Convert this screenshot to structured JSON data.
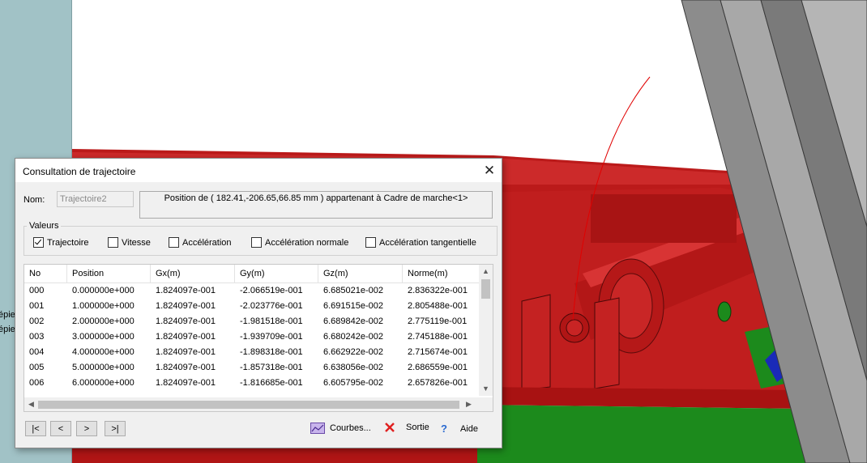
{
  "background": {
    "left_snippets": [
      "épie",
      "épie"
    ]
  },
  "dialog": {
    "title": "Consultation de trajectoire",
    "close_glyph": "✕",
    "nom_label": "Nom:",
    "nom_value": "Trajectoire2",
    "position_text": "Position de ( 182.41,-206.65,66.85  mm ) appartenant à Cadre de marche<1>",
    "group_label": "Valeurs",
    "checkboxes": [
      {
        "label": "Trajectoire",
        "checked": true
      },
      {
        "label": "Vitesse",
        "checked": false
      },
      {
        "label": "Accélération",
        "checked": false
      },
      {
        "label": "Accélération normale",
        "checked": false
      },
      {
        "label": "Accélération tangentielle",
        "checked": false
      }
    ],
    "table": {
      "headers": [
        "No",
        "Position",
        "Gx(m)",
        "Gy(m)",
        "Gz(m)",
        "Norme(m)"
      ],
      "rows": [
        [
          "000",
          "0.000000e+000",
          "1.824097e-001",
          "-2.066519e-001",
          "6.685021e-002",
          "2.836322e-001"
        ],
        [
          "001",
          "1.000000e+000",
          "1.824097e-001",
          "-2.023776e-001",
          "6.691515e-002",
          "2.805488e-001"
        ],
        [
          "002",
          "2.000000e+000",
          "1.824097e-001",
          "-1.981518e-001",
          "6.689842e-002",
          "2.775119e-001"
        ],
        [
          "003",
          "3.000000e+000",
          "1.824097e-001",
          "-1.939709e-001",
          "6.680242e-002",
          "2.745188e-001"
        ],
        [
          "004",
          "4.000000e+000",
          "1.824097e-001",
          "-1.898318e-001",
          "6.662922e-002",
          "2.715674e-001"
        ],
        [
          "005",
          "5.000000e+000",
          "1.824097e-001",
          "-1.857318e-001",
          "6.638056e-002",
          "2.686559e-001"
        ],
        [
          "006",
          "6.000000e+000",
          "1.824097e-001",
          "-1.816685e-001",
          "6.605795e-002",
          "2.657826e-001"
        ]
      ]
    },
    "nav_buttons": [
      "|<",
      "<",
      ">",
      ">|"
    ],
    "actions": {
      "courbes": "Courbes...",
      "sortie": "Sortie",
      "aide": "Aide"
    }
  }
}
